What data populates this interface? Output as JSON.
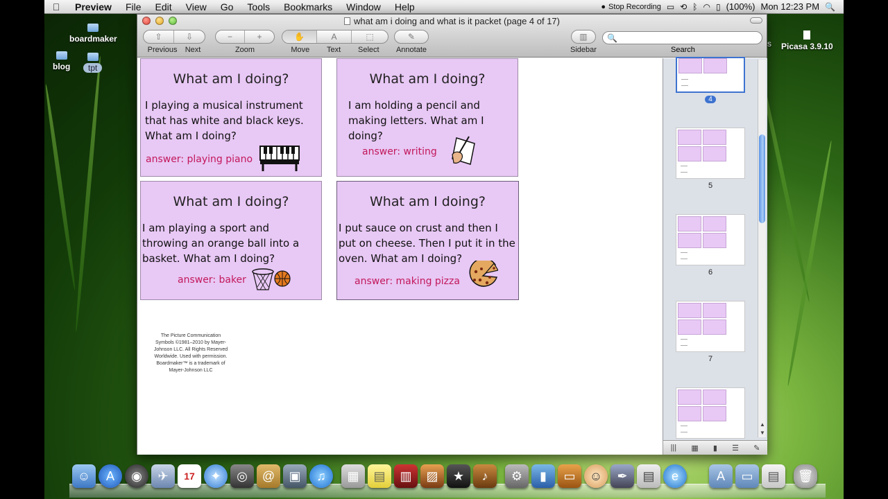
{
  "menubar": {
    "app": "Preview",
    "items": [
      "File",
      "Edit",
      "View",
      "Go",
      "Tools",
      "Bookmarks",
      "Window",
      "Help"
    ],
    "recording": "Stop Recording",
    "battery": "(100%)",
    "clock": "Mon 12:23 PM"
  },
  "desktop": {
    "icons": [
      {
        "label": "boardmaker"
      },
      {
        "label": "blog"
      },
      {
        "label": "tpt"
      },
      {
        "label": "Picasa 3.9.10"
      }
    ],
    "partial": "s"
  },
  "window": {
    "title": "what am i doing and what is it packet (page 4 of 17)",
    "toolbar": {
      "previous": "Previous",
      "next": "Next",
      "zoom": "Zoom",
      "move": "Move",
      "text": "Text",
      "select": "Select",
      "annotate": "Annotate",
      "sidebar": "Sidebar",
      "search": "Search",
      "text_glyph": "A"
    },
    "search_placeholder": ""
  },
  "document": {
    "cards": [
      {
        "title": "What am I doing?",
        "body": "I playing a musical instrument that has white and black keys. What am I doing?",
        "answer": "answer: playing piano"
      },
      {
        "title": "What am I doing?",
        "body": "I am holding a pencil and making letters. What am I doing?",
        "answer": "answer: writing"
      },
      {
        "title": "What am I doing?",
        "body": "I am playing a sport and throwing an orange ball into a basket. What am I doing?",
        "answer": "answer: baker"
      },
      {
        "title": "What am I doing?",
        "body": "I put sauce on crust and then I put on cheese. Then I put it in the oven. What am I doing?",
        "answer": "answer: making pizza"
      }
    ],
    "credits": "The Picture Communication Symbols ©1981–2010 by Mayer-Johnson LLC. All Rights Reserved Worldwide. Used with permission. Boardmaker™ is a trademark of Mayer-Johnson LLC"
  },
  "sidebar": {
    "pages": [
      "4",
      "5",
      "6",
      "7"
    ],
    "current_page": "4"
  }
}
